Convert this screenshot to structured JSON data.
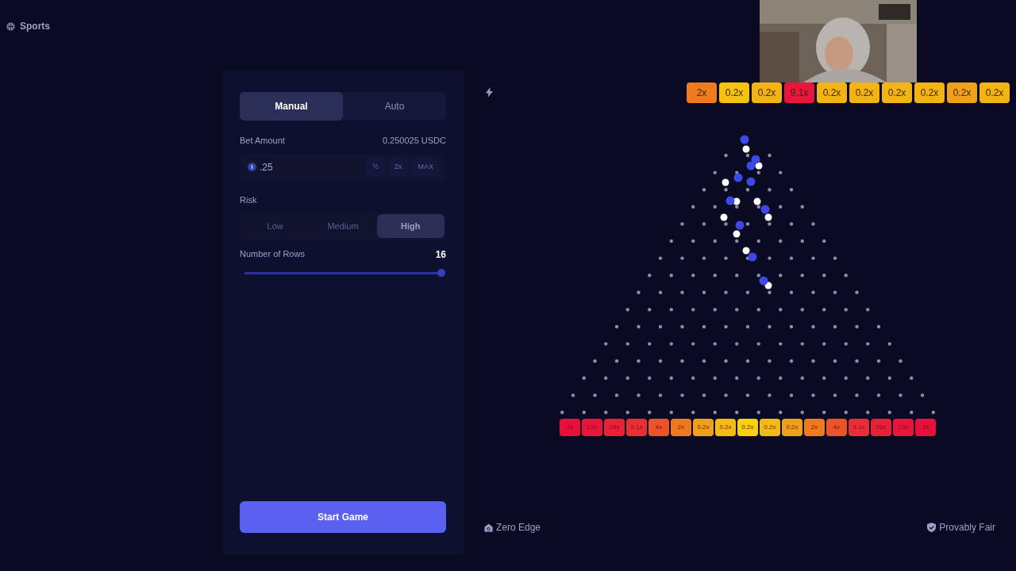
{
  "nav": {
    "label": "Sports"
  },
  "mode_tabs": [
    {
      "label": "Manual",
      "selected": true
    },
    {
      "label": "Auto",
      "selected": false
    }
  ],
  "bet": {
    "label": "Bet Amount",
    "balance": "0.250025 USDC",
    "value": ".25",
    "buttons": [
      "½",
      "2x",
      "MAX"
    ]
  },
  "risk": {
    "label": "Risk",
    "options": [
      {
        "label": "Low",
        "selected": false
      },
      {
        "label": "Medium",
        "selected": false
      },
      {
        "label": "High",
        "selected": true
      }
    ]
  },
  "rows": {
    "label": "Number of Rows",
    "value": "16",
    "level": 1
  },
  "start_button": "Start Game",
  "history": [
    {
      "label": "2x",
      "color": "#f07a1e"
    },
    {
      "label": "0.2x",
      "color": "#f5c211"
    },
    {
      "label": "0.2x",
      "color": "#f3b315"
    },
    {
      "label": "9.1x",
      "color": "#e8173a"
    },
    {
      "label": "0.2x",
      "color": "#f3b315"
    },
    {
      "label": "0.2x",
      "color": "#f3b315"
    },
    {
      "label": "0.2x",
      "color": "#f3b315"
    },
    {
      "label": "0.2x",
      "color": "#f3b315"
    },
    {
      "label": "0.2x",
      "color": "#f0a11a"
    },
    {
      "label": "0.2x",
      "color": "#f3b315"
    }
  ],
  "buckets": [
    {
      "label": "1k",
      "color": "#e8103a"
    },
    {
      "label": "130",
      "color": "#e8163a"
    },
    {
      "label": "26x",
      "color": "#e82038"
    },
    {
      "label": "9.1x",
      "color": "#ea2e34"
    },
    {
      "label": "4x",
      "color": "#ec5428"
    },
    {
      "label": "2x",
      "color": "#ee7a1e"
    },
    {
      "label": "0.2x",
      "color": "#f0a11a"
    },
    {
      "label": "0.2x",
      "color": "#f3bb14"
    },
    {
      "label": "0.2x",
      "color": "#f5d10e"
    },
    {
      "label": "0.2x",
      "color": "#f3bb14"
    },
    {
      "label": "0.2x",
      "color": "#f0a11a"
    },
    {
      "label": "2x",
      "color": "#ee7a1e"
    },
    {
      "label": "4x",
      "color": "#ec5428"
    },
    {
      "label": "9.1x",
      "color": "#ea2e34"
    },
    {
      "label": "26x",
      "color": "#e82038"
    },
    {
      "label": "130",
      "color": "#e8163a"
    },
    {
      "label": "1k",
      "color": "#e8103a"
    }
  ],
  "footer": {
    "left": "Zero Edge",
    "right": "Provably Fair"
  }
}
